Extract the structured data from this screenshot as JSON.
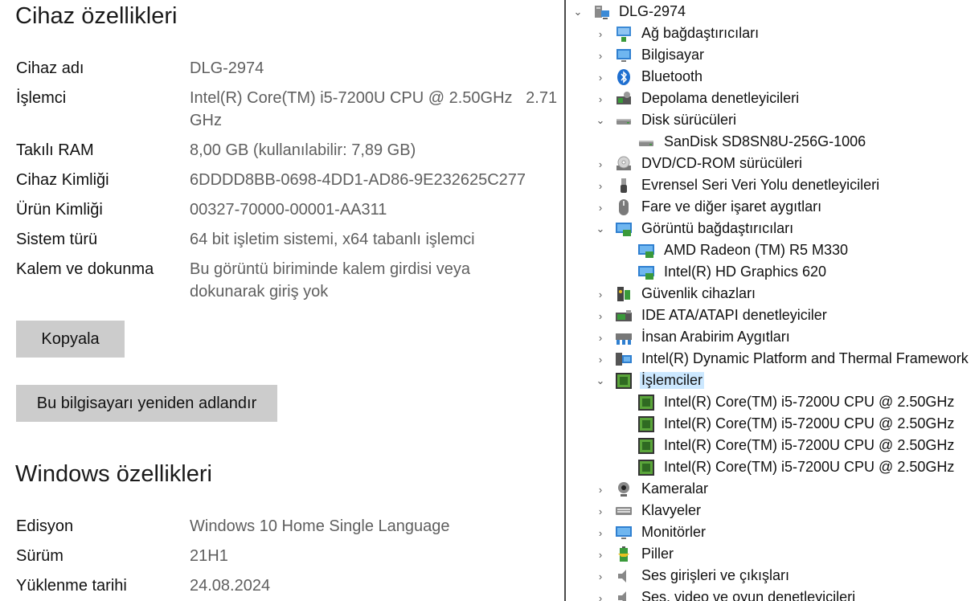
{
  "device_specs": {
    "title": "Cihaz özellikleri",
    "rows": [
      {
        "label": "Cihaz adı",
        "value": "DLG-2974"
      },
      {
        "label": "İşlemci",
        "value": "Intel(R) Core(TM) i5-7200U CPU @ 2.50GHz   2.71 GHz"
      },
      {
        "label": "Takılı RAM",
        "value": "8,00 GB (kullanılabilir: 7,89 GB)"
      },
      {
        "label": "Cihaz Kimliği",
        "value": "6DDDD8BB-0698-4DD1-AD86-9E232625C277"
      },
      {
        "label": "Ürün Kimliği",
        "value": "00327-70000-00001-AA311"
      },
      {
        "label": "Sistem türü",
        "value": "64 bit işletim sistemi, x64 tabanlı işlemci"
      },
      {
        "label": "Kalem ve dokunma",
        "value": "Bu görüntü biriminde kalem girdisi veya dokunarak giriş yok"
      }
    ],
    "copy_button": "Kopyala",
    "rename_button": "Bu bilgisayarı yeniden adlandır"
  },
  "windows_specs": {
    "title": "Windows özellikleri",
    "rows": [
      {
        "label": "Edisyon",
        "value": "Windows 10 Home Single Language"
      },
      {
        "label": "Sürüm",
        "value": "21H1"
      },
      {
        "label": "Yüklenme tarihi",
        "value": "24.08.2024"
      }
    ]
  },
  "device_tree": {
    "root": "DLG-2974",
    "items": [
      {
        "label": "Ağ bağdaştırıcıları",
        "icon": "network-adapter-icon"
      },
      {
        "label": "Bilgisayar",
        "icon": "computer-icon"
      },
      {
        "label": "Bluetooth",
        "icon": "bluetooth-icon"
      },
      {
        "label": "Depolama denetleyicileri",
        "icon": "storage-controller-icon"
      },
      {
        "label": "Disk sürücüleri",
        "icon": "disk-drive-icon"
      },
      {
        "label": "SanDisk SD8SN8U-256G-1006",
        "icon": "disk-drive-icon"
      },
      {
        "label": "DVD/CD-ROM sürücüleri",
        "icon": "dvd-icon"
      },
      {
        "label": "Evrensel Seri Veri Yolu denetleyicileri",
        "icon": "usb-icon"
      },
      {
        "label": "Fare ve diğer işaret aygıtları",
        "icon": "mouse-icon"
      },
      {
        "label": "Görüntü bağdaştırıcıları",
        "icon": "display-adapter-icon"
      },
      {
        "label": "AMD Radeon (TM) R5 M330",
        "icon": "display-adapter-icon"
      },
      {
        "label": "Intel(R) HD Graphics 620",
        "icon": "display-adapter-icon"
      },
      {
        "label": "Güvenlik cihazları",
        "icon": "security-device-icon"
      },
      {
        "label": "IDE ATA/ATAPI denetleyiciler",
        "icon": "ide-controller-icon"
      },
      {
        "label": "İnsan Arabirim Aygıtları",
        "icon": "hid-icon"
      },
      {
        "label": "Intel(R) Dynamic Platform and Thermal Framework",
        "icon": "system-device-icon"
      },
      {
        "label": "İşlemciler",
        "icon": "processor-icon"
      },
      {
        "label": "Intel(R) Core(TM) i5-7200U CPU @ 2.50GHz",
        "icon": "processor-icon"
      },
      {
        "label": "Intel(R) Core(TM) i5-7200U CPU @ 2.50GHz",
        "icon": "processor-icon"
      },
      {
        "label": "Intel(R) Core(TM) i5-7200U CPU @ 2.50GHz",
        "icon": "processor-icon"
      },
      {
        "label": "Intel(R) Core(TM) i5-7200U CPU @ 2.50GHz",
        "icon": "processor-icon"
      },
      {
        "label": "Kameralar",
        "icon": "camera-icon"
      },
      {
        "label": "Klavyeler",
        "icon": "keyboard-icon"
      },
      {
        "label": "Monitörler",
        "icon": "monitor-icon"
      },
      {
        "label": "Piller",
        "icon": "battery-icon"
      },
      {
        "label": "Ses girişleri ve çıkışları",
        "icon": "speaker-icon"
      },
      {
        "label": "Ses, video ve oyun denetleyicileri",
        "icon": "speaker-icon"
      }
    ]
  }
}
